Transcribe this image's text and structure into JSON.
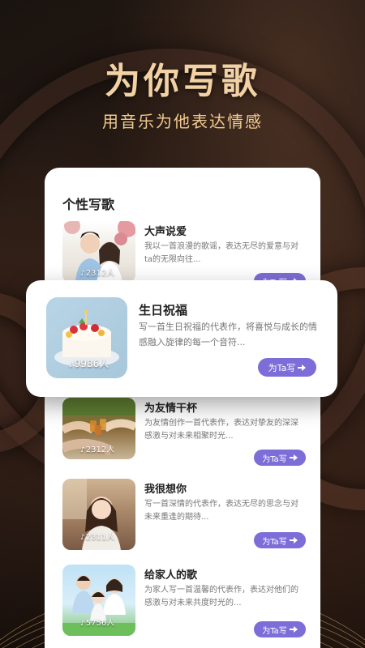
{
  "hero": {
    "title": "为你写歌",
    "subtitle": "用音乐为他表达情感"
  },
  "section": {
    "title": "个性写歌"
  },
  "write_button_label": "为Ta写",
  "songs": [
    {
      "name": "大声说爱",
      "desc": "我以一首浪漫的歌谣，表达无尽的爱意与对ta的无限向往...",
      "count": "2312人"
    },
    {
      "name": "生日祝福",
      "desc": "写一首生日祝福的代表作，将喜悦与成长的情感融入旋律的每一个音符...",
      "count": "9986人"
    },
    {
      "name": "为友情干杯",
      "desc": "为友情创作一首代表作，表达对挚友的深深感激与对未来相聚时光...",
      "count": "2312人"
    },
    {
      "name": "我很想你",
      "desc": "写一首深情的代表作，表达无尽的思念与对未来重逢的期待...",
      "count": "2311人"
    },
    {
      "name": "给家人的歌",
      "desc": "为家人写一首温馨的代表作，表达对他们的感激与对未来共度时光的...",
      "count": "5756人"
    }
  ],
  "colors": {
    "accent": "#7d6dd8",
    "title_gold": "#f2d2a4"
  }
}
